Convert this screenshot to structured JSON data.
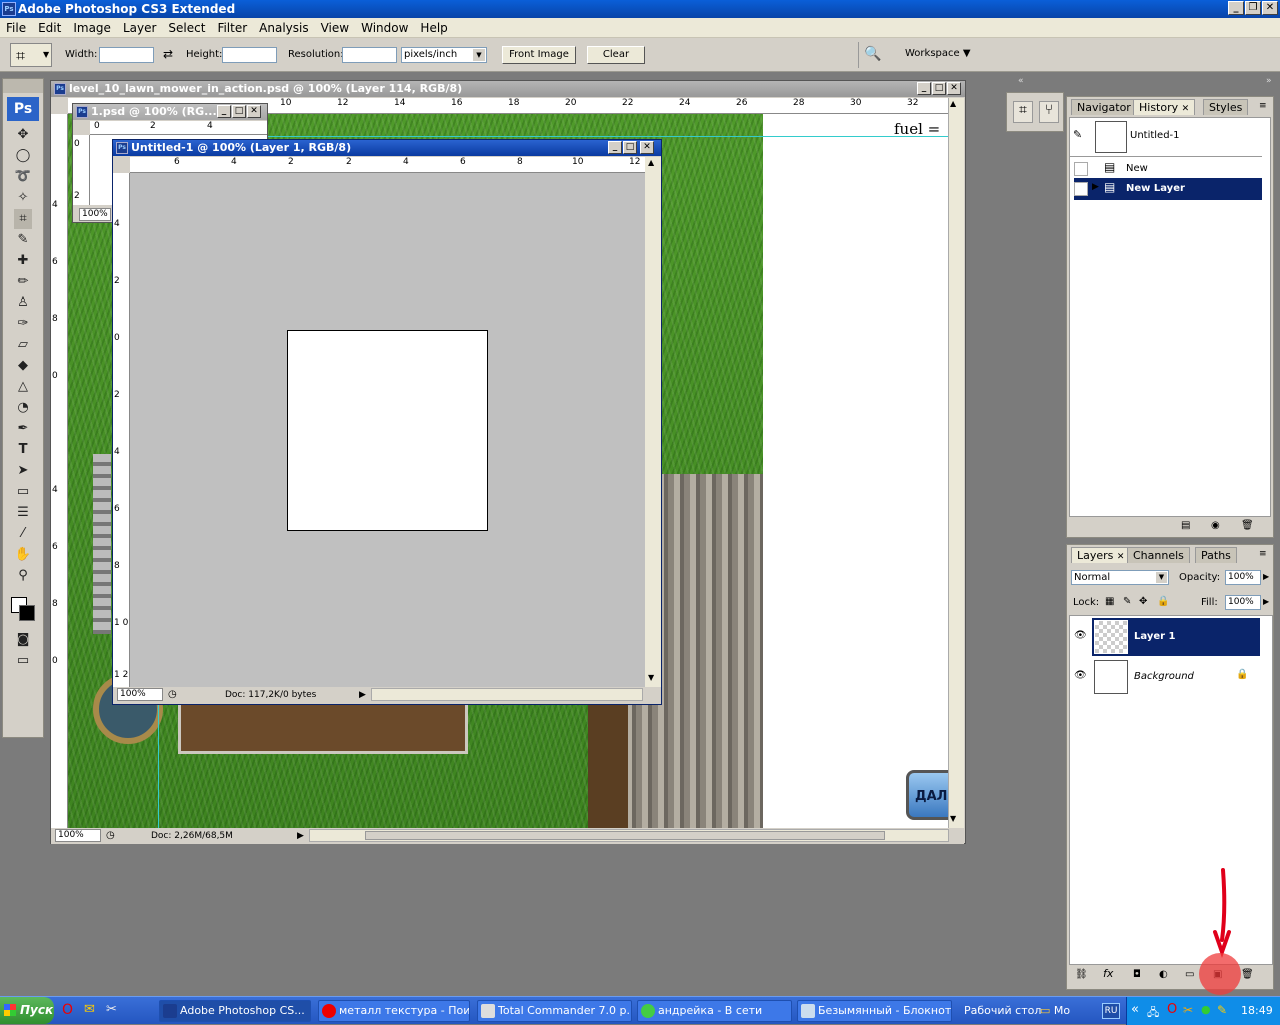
{
  "app": {
    "title": "Adobe Photoshop CS3 Extended",
    "icon": "ps-logo-icon"
  },
  "menu": [
    "File",
    "Edit",
    "Image",
    "Layer",
    "Select",
    "Filter",
    "Analysis",
    "View",
    "Window",
    "Help"
  ],
  "options": {
    "width_label": "Width:",
    "width_value": "",
    "height_label": "Height:",
    "height_value": "",
    "resolution_label": "Resolution:",
    "resolution_value": "",
    "units": "pixels/inch",
    "front_image": "Front Image",
    "clear": "Clear",
    "workspace": "Workspace"
  },
  "toolbox": {
    "logo": "Ps"
  },
  "doc_main": {
    "title": "level_10_lawn_mower_in_action.psd @ 100% (Layer 114, RGB/8)",
    "zoom": "100%",
    "doc_info": "Doc: 2,26M/68,5M",
    "canvas_text": "fuel =",
    "button_text": "ДАЛ",
    "ruler_h": [
      "10",
      "12",
      "14",
      "16",
      "18",
      "20",
      "22",
      "24",
      "26",
      "28",
      "30",
      "32"
    ],
    "ruler_v": [
      "4",
      "6",
      "8",
      "0",
      "4",
      "6",
      "8",
      "0",
      "2",
      "4",
      "6",
      "8",
      "0",
      "2",
      "4"
    ]
  },
  "doc_small": {
    "title": "1.psd @ 100% (RG...",
    "zoom": "100%",
    "ruler_h": [
      "0",
      "2",
      "4"
    ],
    "ruler_v": [
      "0",
      "2"
    ]
  },
  "doc_active": {
    "title": "Untitled-1 @ 100% (Layer 1, RGB/8)",
    "zoom": "100%",
    "doc_info": "Doc: 117,2K/0 bytes",
    "ruler_h": [
      "6",
      "4",
      "2",
      "0",
      "2",
      "4",
      "6",
      "8",
      "10",
      "12"
    ],
    "ruler_v": [
      "4",
      "2",
      "0",
      "2",
      "4",
      "6",
      "8",
      "1 0",
      "1 2"
    ]
  },
  "history_panel": {
    "tabs": [
      "Navigator",
      "History",
      "Styles"
    ],
    "snapshot": "Untitled-1",
    "items": [
      {
        "label": "New",
        "selected": false
      },
      {
        "label": "New Layer",
        "selected": true
      }
    ]
  },
  "layers_panel": {
    "tabs": [
      "Layers",
      "Channels",
      "Paths"
    ],
    "blend_mode": "Normal",
    "opacity_label": "Opacity:",
    "opacity": "100%",
    "lock_label": "Lock:",
    "fill_label": "Fill:",
    "fill": "100%",
    "layers": [
      {
        "name": "Layer 1",
        "selected": true,
        "visible": true
      },
      {
        "name": "Background",
        "selected": false,
        "visible": true,
        "locked": true
      }
    ]
  },
  "taskbar": {
    "start": "Пуск",
    "tasks": [
      {
        "label": "Adobe Photoshop CS...",
        "active": true
      },
      {
        "label": "металл текстура - Пои...",
        "active": false
      },
      {
        "label": "Total Commander 7.0 p...",
        "active": false
      },
      {
        "label": "андрейка - В сети",
        "active": false
      },
      {
        "label": "Безымянный - Блокнот",
        "active": false
      }
    ],
    "desktop": "Рабочий стол",
    "mo": "Мо",
    "lang": "RU",
    "chevron": "«",
    "clock": "18:49"
  },
  "colors": {
    "accent": "#0a246a",
    "annotation": "#e0001a",
    "highlight": "#ef3b3b"
  }
}
